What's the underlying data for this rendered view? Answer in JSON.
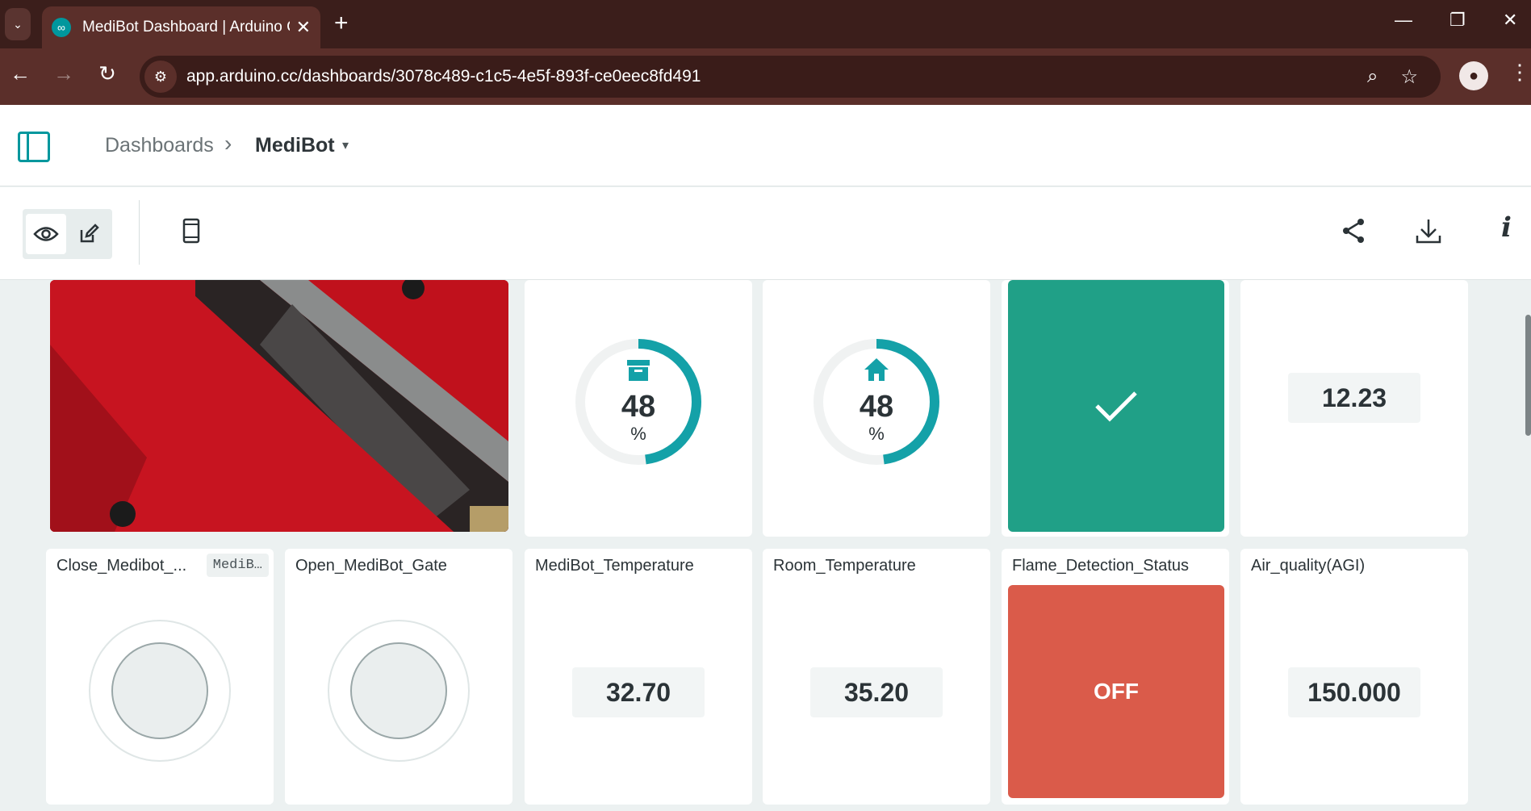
{
  "browser": {
    "tab_title": "MediBot Dashboard | Arduino C",
    "tab_close": "✕",
    "new_tab": "+",
    "url": "app.arduino.cc/dashboards/3078c489-c1c5-4e5f-893f-ce0eec8fd491"
  },
  "header": {
    "breadcrumb_root": "Dashboards",
    "breadcrumb_sep": "›",
    "breadcrumb_current": "MediBot",
    "caret": "▾"
  },
  "widgets": {
    "gauge1": {
      "value": "48",
      "unit": "%",
      "fill": 0.48,
      "icon": "archive-box-icon"
    },
    "gauge2": {
      "value": "48",
      "unit": "%",
      "fill": 0.48,
      "icon": "home-icon"
    },
    "status_top": {
      "state": "ok",
      "icon": "checkmark-icon",
      "color": "#20a087"
    },
    "value_top": "12.23",
    "close_gate": {
      "title": "Close_Medibot_...",
      "chip": "MediB…"
    },
    "open_gate": {
      "title": "Open_MediBot_Gate"
    },
    "medibot_temp": {
      "title": "MediBot_Temperature",
      "value": "32.70"
    },
    "room_temp": {
      "title": "Room_Temperature",
      "value": "35.20"
    },
    "flame": {
      "title": "Flame_Detection_Status",
      "value": "OFF",
      "color": "#da5b4a"
    },
    "air": {
      "title": "Air_quality(AGI)",
      "value": "150.000"
    }
  },
  "colors": {
    "accent": "#00979d",
    "chrome": "#3b1e1b"
  }
}
